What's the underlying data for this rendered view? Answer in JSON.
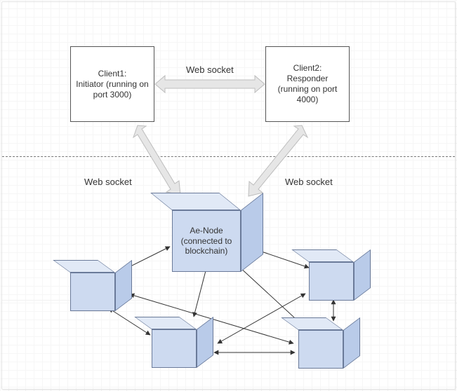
{
  "clients": {
    "client1": {
      "title": "Client1:",
      "desc": "Initiator (running on port 3000)"
    },
    "client2": {
      "title": "Client2:",
      "desc": "Responder (running on port 4000)"
    }
  },
  "labels": {
    "ws_top": "Web socket",
    "ws_left": "Web socket",
    "ws_right": "Web socket"
  },
  "node": {
    "title": "Ae-Node",
    "desc": "(connected to blockchain)"
  },
  "chart_data": {
    "type": "diagram",
    "nodes": [
      {
        "id": "client1",
        "label": "Client1: Initiator (running on port 3000)",
        "kind": "client",
        "port": 3000
      },
      {
        "id": "client2",
        "label": "Client2: Responder (running on port 4000)",
        "kind": "client",
        "port": 4000
      },
      {
        "id": "ae-node",
        "label": "Ae-Node (connected to blockchain)",
        "kind": "main-node"
      },
      {
        "id": "peer1",
        "label": "",
        "kind": "peer-node"
      },
      {
        "id": "peer2",
        "label": "",
        "kind": "peer-node"
      },
      {
        "id": "peer3",
        "label": "",
        "kind": "peer-node"
      },
      {
        "id": "peer4",
        "label": "",
        "kind": "peer-node"
      }
    ],
    "edges": [
      {
        "from": "client1",
        "to": "client2",
        "label": "Web socket",
        "style": "websocket-thick"
      },
      {
        "from": "client1",
        "to": "ae-node",
        "label": "Web socket",
        "style": "websocket-thick"
      },
      {
        "from": "client2",
        "to": "ae-node",
        "label": "Web socket",
        "style": "websocket-thick"
      },
      {
        "from": "ae-node",
        "to": "peer1",
        "style": "thin-bidir"
      },
      {
        "from": "ae-node",
        "to": "peer2",
        "style": "thin-bidir"
      },
      {
        "from": "ae-node",
        "to": "peer3",
        "style": "thin-bidir"
      },
      {
        "from": "ae-node",
        "to": "peer4",
        "style": "thin-bidir"
      },
      {
        "from": "peer1",
        "to": "peer2",
        "style": "thin-bidir"
      },
      {
        "from": "peer1",
        "to": "peer4",
        "style": "thin-bidir"
      },
      {
        "from": "peer2",
        "to": "peer3",
        "style": "thin-bidir"
      },
      {
        "from": "peer2",
        "to": "peer4",
        "style": "thin-bidir"
      },
      {
        "from": "peer3",
        "to": "peer4",
        "style": "thin-bidir"
      }
    ]
  }
}
